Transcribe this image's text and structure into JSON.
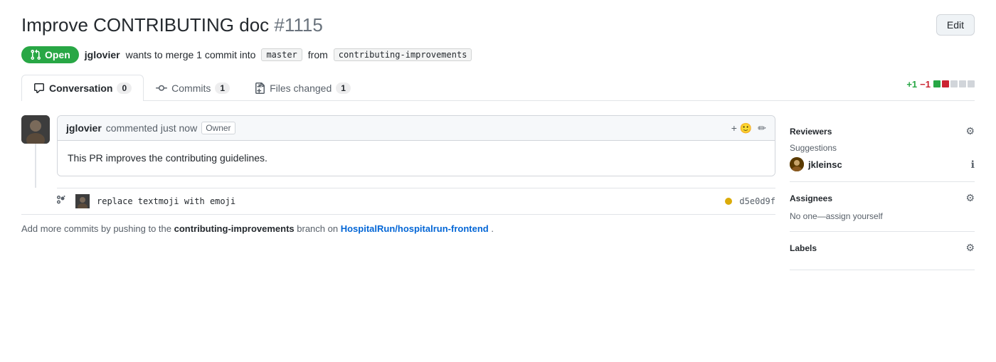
{
  "header": {
    "title": "Improve CONTRIBUTING doc",
    "number": "#1115",
    "edit_label": "Edit"
  },
  "status": {
    "badge_label": "Open",
    "description": "wants to merge 1 commit into",
    "author": "jglovier",
    "target_branch": "master",
    "from_text": "from",
    "source_branch": "contributing-improvements"
  },
  "tabs": [
    {
      "id": "conversation",
      "icon": "comment-icon",
      "label": "Conversation",
      "count": "0",
      "active": true
    },
    {
      "id": "commits",
      "icon": "commit-icon",
      "label": "Commits",
      "count": "1",
      "active": false
    },
    {
      "id": "files_changed",
      "icon": "diff-icon",
      "label": "Files changed",
      "count": "1",
      "active": false
    }
  ],
  "diff_stats": {
    "add": "+1",
    "del": "−1",
    "bars": [
      "green",
      "red",
      "gray",
      "gray",
      "gray"
    ]
  },
  "comment": {
    "author": "jglovier",
    "time": "commented just now",
    "role_badge": "Owner",
    "body": "This PR improves the contributing guidelines."
  },
  "commit": {
    "message": "replace textmoji with emoji",
    "sha": "d5e0d9f",
    "status_color": "#dbab09"
  },
  "footer": {
    "text_before": "Add more commits by pushing to the",
    "branch": "contributing-improvements",
    "text_middle": "branch on",
    "repo": "HospitalRun/hospitalrun-frontend",
    "text_after": "."
  },
  "sidebar": {
    "reviewers_title": "Reviewers",
    "suggestions_label": "Suggestions",
    "reviewer_name": "jkleinsc",
    "assignees_title": "Assignees",
    "no_assignee_text": "No one—assign yourself",
    "labels_title": "Labels"
  }
}
